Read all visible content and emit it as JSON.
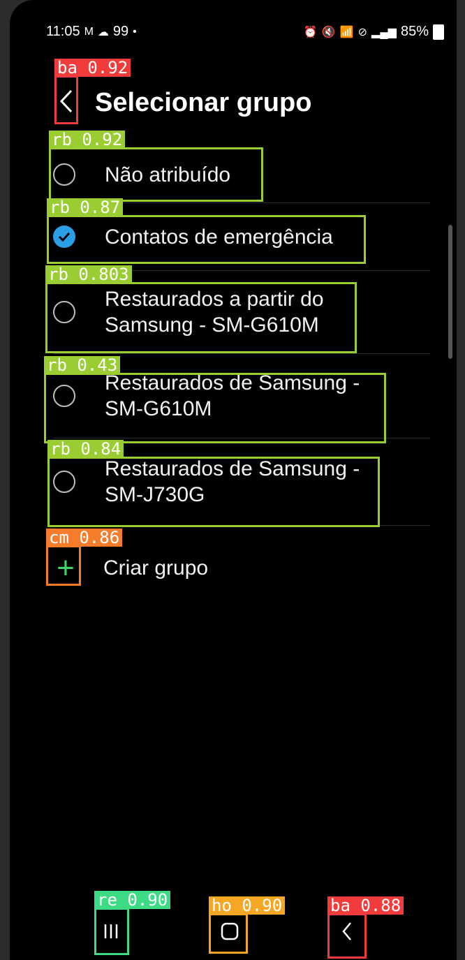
{
  "status": {
    "time": "11:05",
    "notif_text": "99",
    "battery": "85%"
  },
  "header": {
    "title": "Selecionar grupo"
  },
  "groups": [
    {
      "label": "Não atribuído",
      "checked": false
    },
    {
      "label": "Contatos de emergência",
      "checked": true
    },
    {
      "label": "Restaurados a partir do Samsung - SM-G610M",
      "checked": false
    },
    {
      "label": "Restaurados de Samsung - SM-G610M",
      "checked": false
    },
    {
      "label": "Restaurados de Samsung - SM-J730G",
      "checked": false
    }
  ],
  "create_group": {
    "label": "Criar grupo"
  },
  "detections": [
    {
      "label": "ba 0.92",
      "color": "#f23b3b"
    },
    {
      "label": "rb 0.92",
      "color": "#9acd32"
    },
    {
      "label": "rb 0.87",
      "color": "#9acd32"
    },
    {
      "label": "rb 0.803",
      "color": "#9acd32"
    },
    {
      "label": "rb 0.43",
      "color": "#9acd32"
    },
    {
      "label": "rb 0.84",
      "color": "#9acd32"
    },
    {
      "label": "cm 0.86",
      "color": "#f57c2b"
    },
    {
      "label": "re 0.90",
      "color": "#3ddc84"
    },
    {
      "label": "ho 0.90",
      "color": "#f5a623"
    },
    {
      "label": "ba 0.88",
      "color": "#f23b3b"
    }
  ],
  "colors": {
    "accent": "#2b9fe6",
    "plus": "#3dd26b",
    "background": "#000000"
  }
}
